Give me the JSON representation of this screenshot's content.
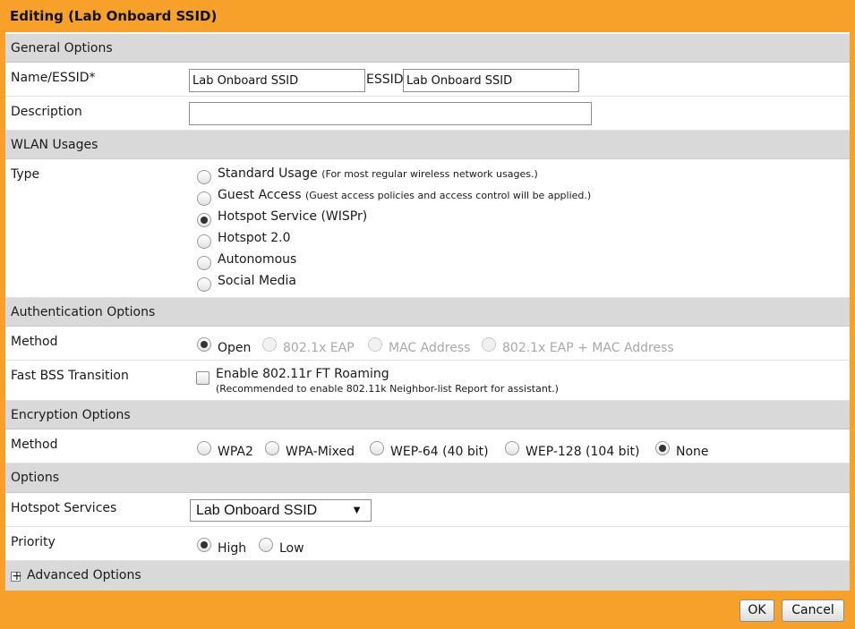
{
  "dialog": {
    "title": "Editing (Lab Onboard SSID)"
  },
  "sections": {
    "general": "General Options",
    "wlan": "WLAN Usages",
    "auth": "Authentication Options",
    "encryption": "Encryption Options",
    "options": "Options",
    "advanced": "Advanced Options"
  },
  "general": {
    "name_label": "Name/ESSID*",
    "name_value": "Lab Onboard SSID",
    "essid_label": "ESSID",
    "essid_value": "Lab Onboard SSID",
    "description_label": "Description",
    "description_value": ""
  },
  "wlan": {
    "type_label": "Type",
    "types": [
      {
        "label": "Standard Usage",
        "hint": "(For most regular wireless network usages.)",
        "selected": false
      },
      {
        "label": "Guest Access",
        "hint": "(Guest access policies and access control will be applied.)",
        "selected": false
      },
      {
        "label": "Hotspot Service (WISPr)",
        "hint": "",
        "selected": true
      },
      {
        "label": "Hotspot 2.0",
        "hint": "",
        "selected": false
      },
      {
        "label": "Autonomous",
        "hint": "",
        "selected": false
      },
      {
        "label": "Social Media",
        "hint": "",
        "selected": false
      }
    ]
  },
  "auth": {
    "method_label": "Method",
    "methods": [
      {
        "label": "Open",
        "selected": true,
        "disabled": false
      },
      {
        "label": "802.1x EAP",
        "selected": false,
        "disabled": true
      },
      {
        "label": "MAC Address",
        "selected": false,
        "disabled": true
      },
      {
        "label": "802.1x EAP + MAC Address",
        "selected": false,
        "disabled": true
      }
    ],
    "fast_bss_label": "Fast BSS Transition",
    "ft_roaming_label": "Enable 802.11r FT Roaming",
    "ft_roaming_checked": false,
    "ft_roaming_note": "(Recommended to enable 802.11k Neighbor-list Report for assistant.)"
  },
  "encryption": {
    "method_label": "Method",
    "methods": [
      {
        "label": "WPA2",
        "selected": false
      },
      {
        "label": "WPA-Mixed",
        "selected": false
      },
      {
        "label": "WEP-64 (40 bit)",
        "selected": false
      },
      {
        "label": "WEP-128 (104 bit)",
        "selected": false
      },
      {
        "label": "None",
        "selected": true
      }
    ]
  },
  "options": {
    "hotspot_label": "Hotspot Services",
    "hotspot_value": "Lab Onboard SSID",
    "priority_label": "Priority",
    "priorities": [
      {
        "label": "High",
        "selected": true
      },
      {
        "label": "Low",
        "selected": false
      }
    ]
  },
  "buttons": {
    "ok": "OK",
    "cancel": "Cancel"
  },
  "colors": {
    "frame": "#f7a12a",
    "section_bg": "#d9d9d9"
  }
}
